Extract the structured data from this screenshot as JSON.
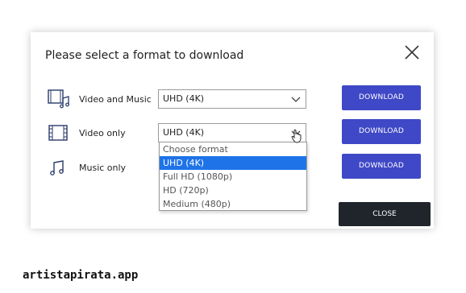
{
  "dialog": {
    "title": "Please select a format to download",
    "close_icon": "close-icon",
    "close_label": "CLOSE"
  },
  "rows": [
    {
      "label": "Video and Music",
      "icon": "video-music-icon",
      "select_value": "UHD (4K)",
      "download_label": "DOWNLOAD"
    },
    {
      "label": "Video only",
      "icon": "film-icon",
      "select_value": "UHD (4K)",
      "download_label": "DOWNLOAD"
    },
    {
      "label": "Music only",
      "icon": "music-note-icon",
      "download_label": "DOWNLOAD"
    }
  ],
  "dropdown": {
    "options": [
      "Choose format",
      "UHD (4K)",
      "Full HD (1080p)",
      "HD (720p)",
      "Medium (480p)"
    ],
    "selected": "UHD (4K)"
  },
  "watermark": "artistapirata.app",
  "colors": {
    "accent": "#3f48c6",
    "close_button": "#20252b",
    "highlight": "#1e73e8"
  }
}
